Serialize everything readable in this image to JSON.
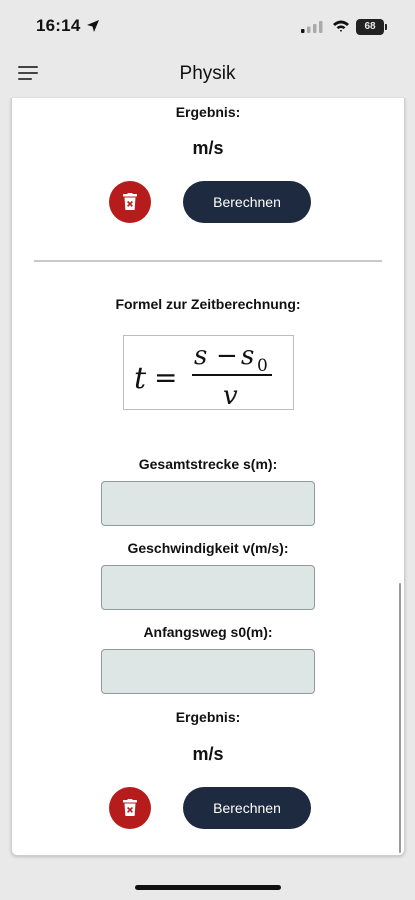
{
  "status_bar": {
    "time": "16:14",
    "battery": "68"
  },
  "app_bar": {
    "title": "Physik"
  },
  "section_velocity": {
    "result_label": "Ergebnis:",
    "result_unit": "m/s",
    "calculate_label": "Berechnen"
  },
  "section_time": {
    "formula_title": "Formel zur Zeitberechnung:",
    "total_distance_label": "Gesamtstrecke s(m):",
    "velocity_label": "Geschwindigkeit v(m/s):",
    "initial_distance_label": "Anfangsweg s0(m):",
    "total_distance_value": "",
    "velocity_value": "",
    "initial_distance_value": "",
    "result_label": "Ergebnis:",
    "result_unit": "m/s",
    "calculate_label": "Berechnen"
  },
  "colors": {
    "delete_button": "#b71c1c",
    "calculate_button": "#1d2a3f",
    "input_background": "#dde5e5"
  },
  "icons": [
    "location-arrow-icon",
    "cell-signal-icon",
    "wifi-icon",
    "battery-icon",
    "menu-icon",
    "trash-icon"
  ]
}
